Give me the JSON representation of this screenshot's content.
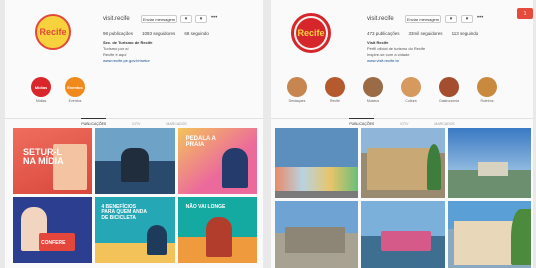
{
  "left_profile": {
    "logo_text": "Recife",
    "username": "visit.recife",
    "follow_label": "Enviar mensagem",
    "more_label": "•••",
    "stats": [
      "98 publicações",
      "1083 seguidores",
      "68 seguindo"
    ],
    "bio_name": "Sec. de Turismo de Recife",
    "bio_lines": [
      "Turismo por aí",
      "Recife é aqui",
      "www.recife.pe.gov.br/setur"
    ],
    "highlights": [
      {
        "label": "Mídias",
        "short": "Mídias",
        "color": "#d9262b"
      },
      {
        "label": "Eventos",
        "short": "Eventos",
        "color": "#f08a1c"
      }
    ],
    "tabs": [
      "PUBLICAÇÕES",
      "IGTV",
      "MARCADOS"
    ],
    "posts": [
      {
        "text": "SETUR-L NA MÍDIA",
        "bg": "#e8574a"
      },
      {
        "text": "",
        "bg": "#3a6a9c"
      },
      {
        "text": "PEDALA A PRAIA",
        "bg": "#e95a8f"
      },
      {
        "text": "CONFERE",
        "bg": "#2b3e8f"
      },
      {
        "text": "4 BENEFÍCIOS PARA QUEM ANDA DE BICICLETA",
        "bg": "#26a7b5"
      },
      {
        "text": "NÃO VAI LONGE",
        "bg": "#14a9a1"
      }
    ]
  },
  "right_profile": {
    "logo_text": "Recife",
    "username": "visit.recife",
    "follow_label": "Enviar mensagem",
    "more_label": "•••",
    "stats": [
      "473 publicações",
      "33mil seguidores",
      "113 seguindo"
    ],
    "bio_name": "Visit Recife",
    "bio_lines": [
      "Perfil oficial de turismo do Recife",
      "Inspire-se com a cidade",
      "www.visit.recife.br"
    ],
    "highlights": [
      {
        "label": "Destaques",
        "color": "#c7864f"
      },
      {
        "label": "Recife",
        "color": "#b55a2e"
      },
      {
        "label": "Museus",
        "color": "#9b6b45"
      },
      {
        "label": "Cultura",
        "color": "#d79a5e"
      },
      {
        "label": "Gastronomia",
        "color": "#a44d2f"
      },
      {
        "label": "Roteiros",
        "color": "#c98a3f"
      }
    ],
    "tabs": [
      "PUBLICAÇÕES",
      "IGTV",
      "MARCADOS"
    ],
    "posts": [
      {
        "bg": "#5c8fbd"
      },
      {
        "bg": "#9a8a6f"
      },
      {
        "bg": "#3c7fb8"
      },
      {
        "bg": "#6d93b5"
      },
      {
        "bg": "#4c7a9a"
      },
      {
        "bg": "#89a9c2"
      }
    ],
    "badge": "1"
  }
}
